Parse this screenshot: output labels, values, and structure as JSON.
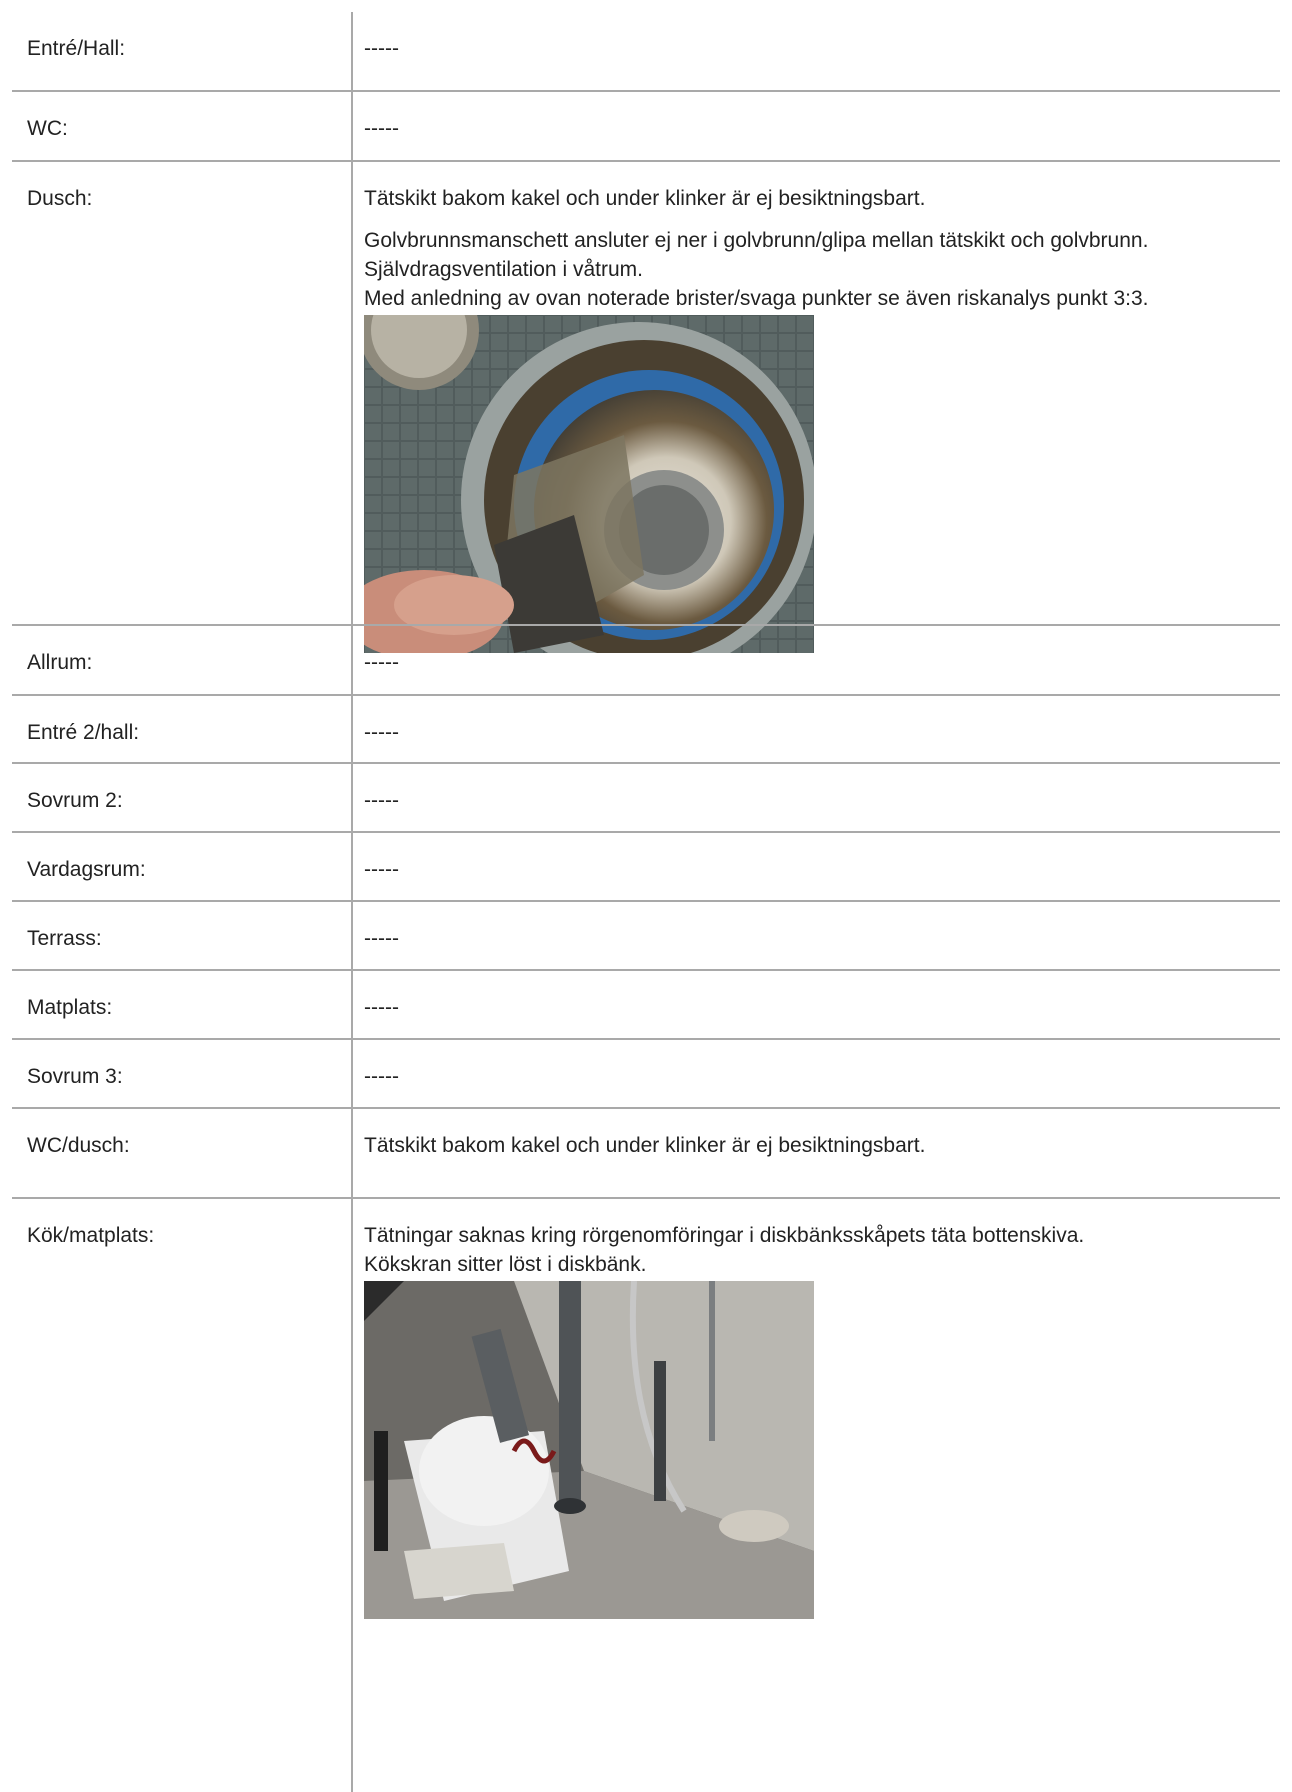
{
  "rows": [
    {
      "label": "Entré/Hall:",
      "text": "-----"
    },
    {
      "label": "WC:",
      "text": "-----"
    },
    {
      "label": "Dusch:",
      "text1": "Tätskikt bakom kakel och under klinker är ej besiktningsbart.",
      "text2": "Golvbrunnsmanschett ansluter ej ner i golvbrunn/glipa mellan tätskikt och golvbrunn.",
      "text3": "Självdragsventilation i våtrum.",
      "text4": "Med anledning av ovan noterade brister/svaga punkter se även riskanalys punkt 3:3."
    },
    {
      "label": "Allrum:",
      "text": "-----"
    },
    {
      "label": "Entré 2/hall:",
      "text": "-----"
    },
    {
      "label": "Sovrum 2:",
      "text": "-----"
    },
    {
      "label": "Vardagsrum:",
      "text": "-----"
    },
    {
      "label": "Terrass:",
      "text": "-----"
    },
    {
      "label": "Matplats:",
      "text": "-----"
    },
    {
      "label": "Sovrum 3:",
      "text": "-----"
    },
    {
      "label": "WC/dusch:",
      "text": "Tätskikt bakom kakel och under klinker är ej besiktningsbart."
    },
    {
      "label": "Kök/matplats:",
      "text1": "Tätningar saknas kring rörgenomföringar i diskbänksskåpets täta bottenskiva.",
      "text2": "Kökskran sitter löst i diskbänk."
    }
  ]
}
